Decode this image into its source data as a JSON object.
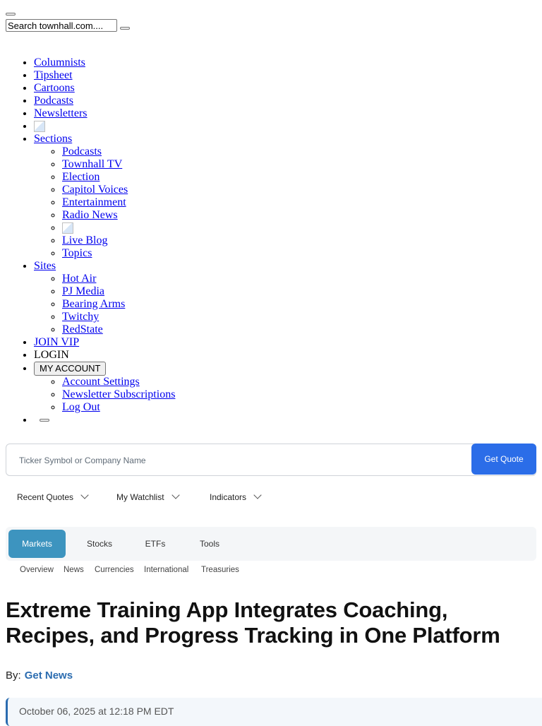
{
  "header": {
    "search": {
      "placeholder": "Search townhall.com...."
    }
  },
  "nav": {
    "items": [
      {
        "label": "Columnists"
      },
      {
        "label": "Tipsheet"
      },
      {
        "label": "Cartoons"
      },
      {
        "label": "Podcasts"
      },
      {
        "label": "Newsletters"
      }
    ],
    "sections": {
      "label": "Sections",
      "items": [
        {
          "label": "Podcasts"
        },
        {
          "label": "Townhall TV"
        },
        {
          "label": "Election"
        },
        {
          "label": "Capitol Voices"
        },
        {
          "label": "Entertainment"
        },
        {
          "label": "Radio News"
        },
        {
          "label": "Live Blog"
        },
        {
          "label": "Topics"
        }
      ]
    },
    "sites": {
      "label": "Sites",
      "items": [
        {
          "label": "Hot Air"
        },
        {
          "label": "PJ Media"
        },
        {
          "label": "Bearing Arms"
        },
        {
          "label": "Twitchy"
        },
        {
          "label": "RedState"
        }
      ]
    },
    "join_vip": "JOIN VIP",
    "login": "LOGIN",
    "account": {
      "button": "MY ACCOUNT",
      "items": [
        {
          "label": "Account Settings"
        },
        {
          "label": "Newsletter Subscriptions"
        },
        {
          "label": "Log Out"
        }
      ]
    }
  },
  "finance": {
    "quote": {
      "placeholder": "Ticker Symbol or Company Name",
      "button": "Get Quote"
    },
    "dropdowns": [
      {
        "label": "Recent Quotes"
      },
      {
        "label": "My Watchlist"
      },
      {
        "label": "Indicators"
      }
    ],
    "tabs": [
      {
        "label": "Markets"
      },
      {
        "label": "Stocks"
      },
      {
        "label": "ETFs"
      },
      {
        "label": "Tools"
      }
    ],
    "active_tab": "Markets",
    "subnav": [
      {
        "label": "Overview"
      },
      {
        "label": "News"
      },
      {
        "label": "Currencies"
      },
      {
        "label": "International"
      },
      {
        "label": "Treasuries"
      }
    ]
  },
  "article": {
    "headline": "Extreme Training App Integrates Coaching, Recipes, and Progress Tracking in One Platform",
    "byline_prefix": "By:",
    "author": "Get News",
    "date": "October 06, 2025 at 12:18 PM EDT"
  },
  "colors": {
    "quote_button": "#2b6de8",
    "active_tab": "#3d94bf",
    "author_link": "#2b6cb0"
  }
}
